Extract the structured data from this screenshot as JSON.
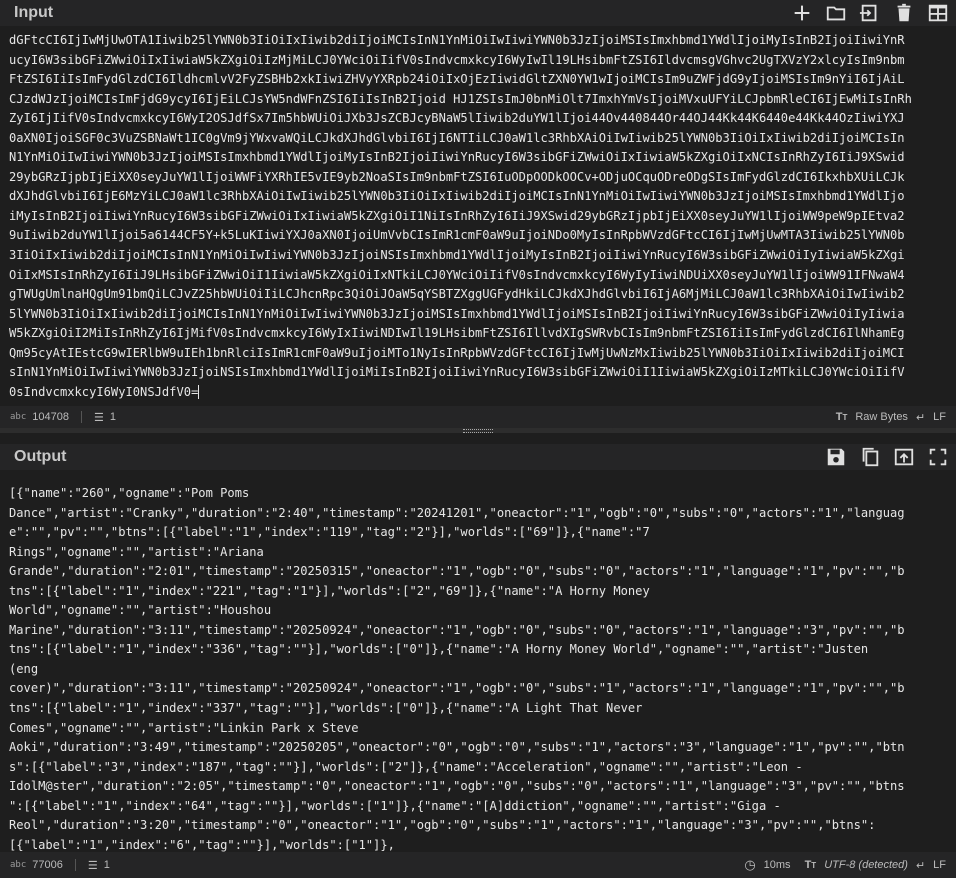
{
  "input": {
    "title": "Input",
    "lines": [
      "dGFtcCI6IjIwMjUwOTA1Iiwib25lYWN0b3IiOiIxIiwib2diIjoiMCIsInN1YnMiOiIwIiwiYWN0b3JzIjoiMSIsImxhbmd1YWdlIjoiMyIsInB2IjoiIiwiYnR",
      "ucyI6W3sibGFiZWwiOiIxIiwiaW5kZXgiOiIzMjMiLCJ0YWciOiIifV0sIndvcmxkcyI6WyIwIl19LHsibmFtZSI6IldvcmsgVGhvc2UgTXVzY2xlcyIsIm9nbm",
      "FtZSI6IiIsImFydGlzdCI6IldhcmlvV2FyZSBHb2xkIiwiZHVyYXRpb24iOiIxOjEzIiwidGltZXN0YW1wIjoiMCIsIm9uZWFjdG9yIjoiMSIsIm9nYiI6IjAiL",
      "CJzdWJzIjoiMCIsImFjdG9ycyI6IjEiLCJsYW5ndWFnZSI6IiIsInB2Ijoid HJ1ZSIsImJ0bnMiOlt7ImxhYmVsIjoiMVxuUFYiLCJpbmRleCI6IjEwMiIsInRh",
      "ZyI6IjIifV0sIndvcmxkcyI6WyI2OSJdfSx7Im5hbWUiOiJXb3JsZCBJcyBNaW5lIiwib2duYW1lIjoi44Ov440844Or44OJ44Kk44K6440e44Kk44OzIiwiYXJ",
      "0aXN0IjoiSGF0c3VuZSBNaWt1IC0gVm9jYWxvaWQiLCJkdXJhdGlvbiI6IjI6NTIiLCJ0aW1lc3RhbXAiOiIwIiwib25lYWN0b3IiOiIxIiwib2diIjoiMCIsIn",
      "N1YnMiOiIwIiwiYWN0b3JzIjoiMSIsImxhbmd1YWdlIjoiMyIsInB2IjoiIiwiYnRucyI6W3sibGFiZWwiOiIxIiwiaW5kZXgiOiIxNCIsInRhZyI6IiJ9XSwid",
      "29ybGRzIjpbIjEiXX0seyJuYW1lIjoiWWFiYXRhIE5vIE9yb2NoaSIsIm9nbmFtZSI6IuODpOODkOOCv+ODjuOCquODreODgSIsImFydGlzdCI6IkxhbXUiLCJk",
      "dXJhdGlvbiI6IjE6MzYiLCJ0aW1lc3RhbXAiOiIwIiwib25lYWN0b3IiOiIxIiwib2diIjoiMCIsInN1YnMiOiIwIiwiYWN0b3JzIjoiMSIsImxhbmd1YWdlIjo",
      "iMyIsInB2IjoiIiwiYnRucyI6W3sibGFiZWwiOiIxIiwiaW5kZXgiOiI1NiIsInRhZyI6IiJ9XSwid29ybGRzIjpbIjEiXX0seyJuYW1lIjoiWW9peW9pIEtva2",
      "9uIiwib2duYW1lIjoi5a6144CF5Y+k5LuKIiwiYXJ0aXN0IjoiUmVvbCIsImR1cmF0aW9uIjoiNDo0MyIsInRpbWVzdGFtcCI6IjIwMjUwMTA3Iiwib25lYWN0b",
      "3IiOiIxIiwib2diIjoiMCIsInN1YnMiOiIwIiwiYWN0b3JzIjoiNSIsImxhbmd1YWdlIjoiMyIsInB2IjoiIiwiYnRucyI6W3sibGFiZWwiOiIyIiwiaW5kZXgi",
      "OiIxMSIsInRhZyI6IiJ9LHsibGFiZWwiOiI1IiwiaW5kZXgiOiIxNTkiLCJ0YWciOiIifV0sIndvcmxkcyI6WyIyIiwiNDUiXX0seyJuYW1lIjoiWW91IFNwaW4",
      "gTWUgUmlnaHQgUm91bmQiLCJvZ25hbWUiOiIiLCJhcnRpc3QiOiJOaW5qYSBTZXggUGFydHkiLCJkdXJhdGlvbiI6IjA6MjMiLCJ0aW1lc3RhbXAiOiIwIiwib2",
      "5lYWN0b3IiOiIxIiwib2diIjoiMCIsInN1YnMiOiIwIiwiYWN0b3JzIjoiMSIsImxhbmd1YWdlIjoiMSIsInB2IjoiIiwiYnRucyI6W3sibGFiZWwiOiIyIiwia",
      "W5kZXgiOiI2MiIsInRhZyI6IjMifV0sIndvcmxkcyI6WyIxIiwiNDIwIl19LHsibmFtZSI6IllvdXIgSWRvbCIsIm9nbmFtZSI6IiIsImFydGlzdCI6IlNhamEg",
      "Qm95cyAtIEstcG9wIERlbW9uIEh1bnRlciIsImR1cmF0aW9uIjoiMTo1NyIsInRpbWVzdGFtcCI6IjIwMjUwNzMxIiwib25lYWN0b3IiOiIxIiwib2diIjoiMCI",
      "sInN1YnMiOiIwIiwiYWN0b3JzIjoiNSIsImxhbmd1YWdlIjoiMiIsInB2IjoiIiwiYnRucyI6W3sibGFiZWwiOiI1IiwiaW5kZXgiOiIzMTkiLCJ0YWciOiIifV",
      "0sIndvcmxkcyI6WyI0NSJdfV0="
    ],
    "status_length": "104708",
    "status_lines": "1",
    "format_label": "Raw Bytes",
    "eol_label": "LF"
  },
  "output": {
    "title": "Output",
    "lines": [
      "[{\"name\":\"260\",\"ogname\":\"Pom Poms",
      "Dance\",\"artist\":\"Cranky\",\"duration\":\"2:40\",\"timestamp\":\"20241201\",\"oneactor\":\"1\",\"ogb\":\"0\",\"subs\":\"0\",\"actors\":\"1\",\"languag",
      "e\":\"\",\"pv\":\"\",\"btns\":[{\"label\":\"1\",\"index\":\"119\",\"tag\":\"2\"}],\"worlds\":[\"69\"]},{\"name\":\"7",
      "Rings\",\"ogname\":\"\",\"artist\":\"Ariana",
      "Grande\",\"duration\":\"2:01\",\"timestamp\":\"20250315\",\"oneactor\":\"1\",\"ogb\":\"0\",\"subs\":\"0\",\"actors\":\"1\",\"language\":\"1\",\"pv\":\"\",\"b",
      "tns\":[{\"label\":\"1\",\"index\":\"221\",\"tag\":\"1\"}],\"worlds\":[\"2\",\"69\"]},{\"name\":\"A Horny Money",
      "World\",\"ogname\":\"\",\"artist\":\"Houshou",
      "Marine\",\"duration\":\"3:11\",\"timestamp\":\"20250924\",\"oneactor\":\"1\",\"ogb\":\"0\",\"subs\":\"0\",\"actors\":\"1\",\"language\":\"3\",\"pv\":\"\",\"b",
      "tns\":[{\"label\":\"1\",\"index\":\"336\",\"tag\":\"\"}],\"worlds\":[\"0\"]},{\"name\":\"A Horny Money World\",\"ogname\":\"\",\"artist\":\"Justen",
      "(eng",
      "cover)\",\"duration\":\"3:11\",\"timestamp\":\"20250924\",\"oneactor\":\"1\",\"ogb\":\"0\",\"subs\":\"1\",\"actors\":\"1\",\"language\":\"1\",\"pv\":\"\",\"b",
      "tns\":[{\"label\":\"1\",\"index\":\"337\",\"tag\":\"\"}],\"worlds\":[\"0\"]},{\"name\":\"A Light That Never",
      "Comes\",\"ogname\":\"\",\"artist\":\"Linkin Park x Steve",
      "Aoki\",\"duration\":\"3:49\",\"timestamp\":\"20250205\",\"oneactor\":\"0\",\"ogb\":\"0\",\"subs\":\"1\",\"actors\":\"3\",\"language\":\"1\",\"pv\":\"\",\"btn",
      "s\":[{\"label\":\"3\",\"index\":\"187\",\"tag\":\"\"}],\"worlds\":[\"2\"]},{\"name\":\"Acceleration\",\"ogname\":\"\",\"artist\":\"Leon -",
      "IdolM@ster\",\"duration\":\"2:05\",\"timestamp\":\"0\",\"oneactor\":\"1\",\"ogb\":\"0\",\"subs\":\"0\",\"actors\":\"1\",\"language\":\"3\",\"pv\":\"\",\"btns",
      "\":[{\"label\":\"1\",\"index\":\"64\",\"tag\":\"\"}],\"worlds\":[\"1\"]},{\"name\":\"[A]ddiction\",\"ogname\":\"\",\"artist\":\"Giga -",
      "Reol\",\"duration\":\"3:20\",\"timestamp\":\"0\",\"oneactor\":\"1\",\"ogb\":\"0\",\"subs\":\"1\",\"actors\":\"1\",\"language\":\"3\",\"pv\":\"\",\"btns\":",
      "[{\"label\":\"1\",\"index\":\"6\",\"tag\":\"\"}],\"worlds\":[\"1\"]},"
    ],
    "status_length": "77006",
    "status_lines": "1",
    "time_label": "10ms",
    "format_label": "UTF-8 (detected)",
    "eol_label": "LF"
  },
  "status_icon_text": "abc",
  "icons": [
    "add-icon",
    "folder-icon",
    "import-icon",
    "trash-icon",
    "layout-icon",
    "save-icon",
    "copy-icon",
    "replace-input-icon",
    "maximize-icon",
    "clock-icon",
    "text-format-icon",
    "return-arrow-icon",
    "line-count-icon"
  ],
  "colors": {
    "background": "#1e1e1e",
    "header": "#252526",
    "text": "#e6e6e6"
  }
}
